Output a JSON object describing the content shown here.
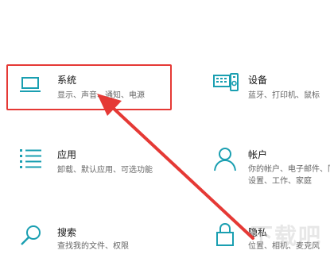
{
  "tiles": {
    "system": {
      "title": "系统",
      "desc": "显示、声音、通知、电源",
      "icon": "laptop-icon"
    },
    "devices": {
      "title": "设备",
      "desc": "蓝牙、打印机、鼠标",
      "icon": "keyboard-device-icon"
    },
    "apps": {
      "title": "应用",
      "desc_line1": "卸载、默认应用、可选功能",
      "icon": "apps-list-icon"
    },
    "accounts": {
      "title": "帐户",
      "desc_line1": "你的帐户、电子邮件、同步",
      "desc_line2": "设置、工作、家庭",
      "icon": "person-icon"
    },
    "search": {
      "title": "搜索",
      "desc": "查找我的文件、权限",
      "icon": "search-icon"
    },
    "privacy": {
      "title": "隐私",
      "desc": "位置、相机、麦克风",
      "icon": "lock-icon"
    }
  },
  "colors": {
    "icon_accent": "#1a9fb1",
    "highlight": "#e53935"
  }
}
